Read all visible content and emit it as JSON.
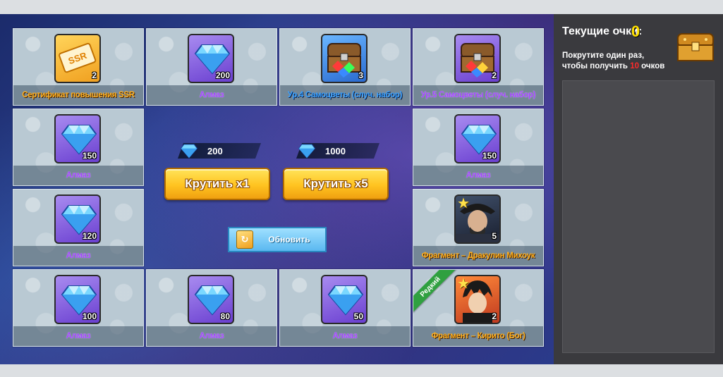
{
  "cards": [
    {
      "label": "Сертификат повышения SSR",
      "qty": "2",
      "type": "ticket",
      "label_color": "orange",
      "icon": "ssr-ticket-icon"
    },
    {
      "label": "Алмаз",
      "qty": "200",
      "type": "diamond",
      "label_color": "purple",
      "icon": "diamond-icon"
    },
    {
      "label": "Ур.4 Самоцветы (случ. набор)",
      "qty": "3",
      "type": "chest",
      "label_color": "blue",
      "icon": "gem-chest-icon"
    },
    {
      "label": "Ур.5 Самоцветы (случ. набор)",
      "qty": "2",
      "type": "chest",
      "label_color": "purple",
      "icon": "gem-chest-icon"
    },
    {
      "label": "Алмаз",
      "qty": "150",
      "type": "diamond",
      "label_color": "purple",
      "icon": "diamond-icon"
    },
    {
      "label": "Алмаз",
      "qty": "150",
      "type": "diamond",
      "label_color": "purple",
      "icon": "diamond-icon"
    },
    {
      "label": "Алмаз",
      "qty": "120",
      "type": "diamond",
      "label_color": "purple",
      "icon": "diamond-icon"
    },
    {
      "label": "Фрагмент – Дракулин Михоук",
      "qty": "5",
      "type": "char",
      "label_color": "orange",
      "icon": "character-portrait-icon"
    },
    {
      "label": "Алмаз",
      "qty": "100",
      "type": "diamond",
      "label_color": "purple",
      "icon": "diamond-icon"
    },
    {
      "label": "Алмаз",
      "qty": "80",
      "type": "diamond",
      "label_color": "purple",
      "icon": "diamond-icon"
    },
    {
      "label": "Алмаз",
      "qty": "50",
      "type": "diamond",
      "label_color": "purple",
      "icon": "diamond-icon"
    },
    {
      "label": "Фрагмент – Кирито (Бог)",
      "qty": "2",
      "type": "char",
      "label_color": "orange",
      "icon": "character-portrait-icon",
      "ribbon": "Редкий"
    }
  ],
  "spin": {
    "x1": {
      "cost": "200",
      "label": "Крутить x1"
    },
    "x5": {
      "cost": "1000",
      "label": "Крутить x5"
    }
  },
  "refresh": {
    "label": "Обновить"
  },
  "sidebar": {
    "score_title": "Текущие очки:",
    "score_value": "0",
    "hint_before": "Покрутите один раз, чтобы получить ",
    "hint_points": "10",
    "hint_after": " очков"
  },
  "colors": {
    "purple_label": "#a040ff",
    "orange_label": "#ffb020",
    "blue_label": "#3aa0ff",
    "spin_button": "#ffc320",
    "refresh_button": "#5ab8f0",
    "score_value": "#ffe000"
  }
}
